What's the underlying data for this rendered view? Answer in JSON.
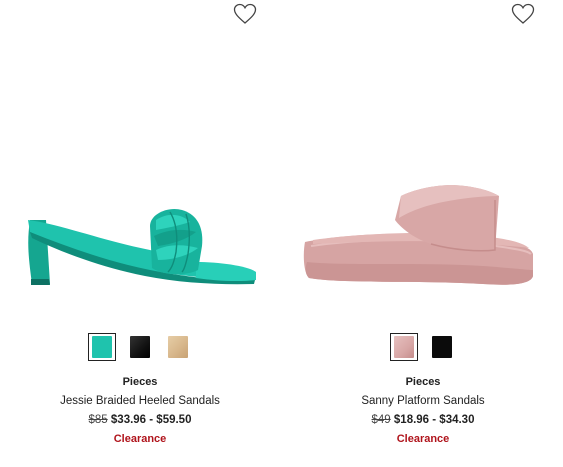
{
  "products": [
    {
      "brand": "Pieces",
      "name": "Jessie Braided Heeled Sandals",
      "original_price": "$85",
      "sale_price": "$33.96 - $59.50",
      "badge": "Clearance",
      "swatches": [
        {
          "color": "#1fc3ad",
          "selected": true
        },
        {
          "color": "#111111",
          "selected": false
        },
        {
          "color": "#d9b98e",
          "selected": false
        }
      ],
      "icons": {
        "wishlist": "heart-icon"
      }
    },
    {
      "brand": "Pieces",
      "name": "Sanny Platform Sandals",
      "original_price": "$49",
      "sale_price": "$18.96 - $34.30",
      "badge": "Clearance",
      "swatches": [
        {
          "color": "#d8a7a6",
          "selected": true
        },
        {
          "color": "#111111",
          "selected": false
        }
      ],
      "icons": {
        "wishlist": "heart-icon"
      }
    }
  ],
  "colors": {
    "clearance": "#b0141c",
    "teal_sandal": "#1fc3ad",
    "pink_sandal": "#d8a7a6"
  }
}
